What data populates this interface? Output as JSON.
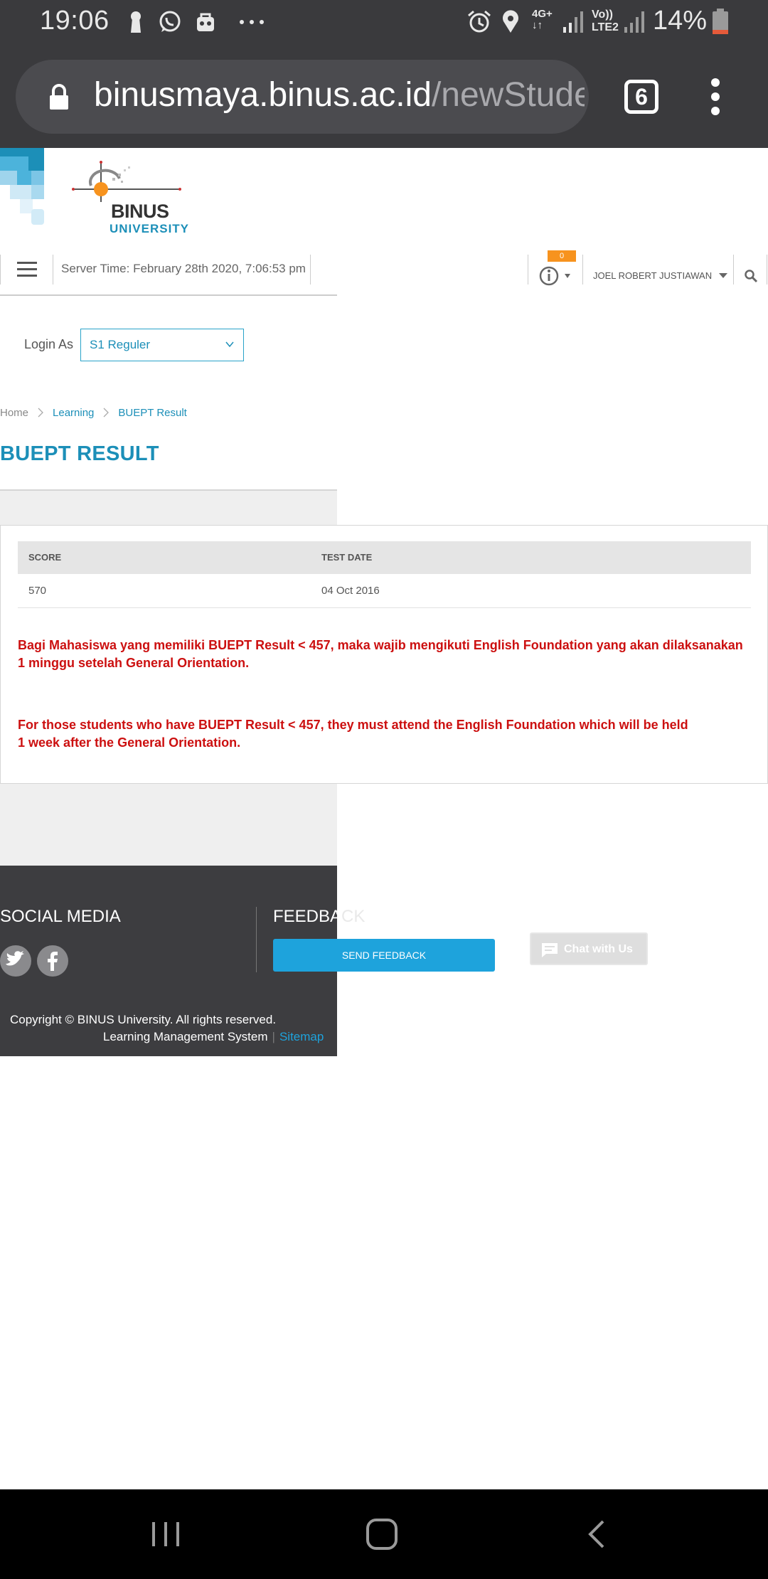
{
  "status_bar": {
    "time": "19:06",
    "battery_percent": "14%",
    "icons": [
      "keyhole-icon",
      "whatsapp-icon",
      "bag-icon",
      "more-dots-icon",
      "alarm-icon",
      "location-icon",
      "4g-icon",
      "signal-icon",
      "volte-lte2-icon",
      "signal2-icon",
      "battery-icon"
    ],
    "network_label_1": "4G+",
    "network_label_2": "Vo))",
    "network_label_3": "LTE2"
  },
  "browser": {
    "url_host": "binusmaya.binus.ac.id",
    "url_path": "/newStude",
    "tab_count": "6"
  },
  "site": {
    "logo": {
      "line1": "BINUS",
      "line2": "UNIVERSITY"
    },
    "server_time": "Server Time: February 28th 2020, 7:06:53 pm",
    "notification_count": "0",
    "user_name": "JOEL ROBERT JUSTIAWAN",
    "login_as_label": "Login As",
    "login_as_value": "S1 Reguler",
    "breadcrumb": {
      "home": "Home",
      "learning": "Learning",
      "current": "BUEPT Result"
    },
    "page_title": "BUEPT RESULT",
    "table": {
      "headers": [
        "SCORE",
        "TEST DATE"
      ],
      "rows": [
        [
          "570",
          "04 Oct 2016"
        ]
      ]
    },
    "notice_id_line1": "Bagi Mahasiswa yang memiliki BUEPT Result < 457, maka wajib mengikuti English Foundation yang akan dilaksanakan",
    "notice_id_line2": "1 minggu setelah General Orientation.",
    "notice_en_line1": "For those students who have BUEPT Result < 457, they must attend the English Foundation which will be held",
    "notice_en_line2": "1 week after the General Orientation.",
    "footer": {
      "social_title": "SOCIAL MEDIA",
      "feedback_title_a": "FEEDBA",
      "feedback_title_b": "CK",
      "send_feedback": "SEND FEEDBACK",
      "chat_label": "Chat with Us",
      "copyright": "Copyright © BINUS University. All rights reserved.",
      "lms": "Learning Management System",
      "sitemap": "Sitemap"
    }
  },
  "colors": {
    "accent": "#1c8fb8",
    "alert": "#cc1010",
    "footer_bg": "#3d3d40",
    "badge": "#f7931e"
  }
}
